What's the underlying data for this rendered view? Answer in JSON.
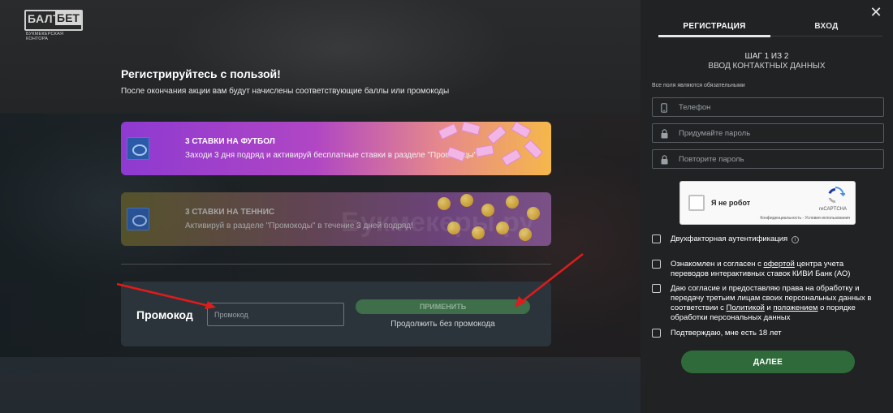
{
  "logo": {
    "part1": "БАЛТ",
    "part2": "БЕТ",
    "tagline": "БУКМЕКЕРСКАЯ КОНТОРА"
  },
  "promo": {
    "title": "Регистрируйтесь с пользой!",
    "subtitle": "После окончания акции вам будут начислены соответствующие баллы или промокоды",
    "cards": [
      {
        "title": "3 СТАВКИ НА ФУТБОЛ",
        "desc": "Заходи 3 дня подряд и активируй бесплатные ставки в разделе \"Промокоды\"!",
        "icon": "card-logo-icon"
      },
      {
        "title": "3 СТАВКИ НА ТЕННИС",
        "desc": "Активируй в разделе \"Промокоды\" в течение 3 дней подряд!",
        "icon": "card-logo-icon"
      }
    ],
    "panel": {
      "label": "Промокод",
      "input_placeholder": "Промокод",
      "apply_label": "ПРИМЕНИТЬ",
      "continue_label": "Продолжить без промокода"
    },
    "watermark": "Букмекеры.ру"
  },
  "registration": {
    "close_icon": "close-icon",
    "tabs": [
      {
        "label": "РЕГИСТРАЦИЯ",
        "active": true
      },
      {
        "label": "ВХОД",
        "active": false
      }
    ],
    "step": "ШАГ 1 ИЗ 2",
    "step_title": "ВВОД КОНТАКТНЫХ ДАННЫХ",
    "required_note": "Все поля являются обязательными",
    "fields": {
      "phone": {
        "placeholder": "Телефон",
        "icon": "phone-icon"
      },
      "password": {
        "placeholder": "Придумайте пароль",
        "icon": "lock-icon"
      },
      "password_repeat": {
        "placeholder": "Повторите пароль",
        "icon": "lock-icon"
      }
    },
    "captcha": {
      "label": "Я не робот",
      "brand": "reCAPTCHA",
      "links": "Конфиденциальность - Условия использования"
    },
    "checkboxes": {
      "two_factor": "Двухфакторная аутентификация",
      "offer": {
        "pre": "Ознакомлен и согласен с ",
        "link": "офертой",
        "post": " центра учета переводов интерактивных ставок КИВИ Банк (АО)"
      },
      "consent": {
        "pre": "Даю согласие и предоставляю права на обработку и передачу третьим лицам своих персональных данных в соответствии с ",
        "link1": "Политикой",
        "mid": " и ",
        "link2": "положением",
        "post": " о порядке обработки персональных данных"
      },
      "age": "Подтверждаю, мне есть 18 лет"
    },
    "next_label": "ДАЛЕЕ"
  },
  "colors": {
    "accent_green": "#2f6b3a",
    "card1_gradient": "#8e3ad1",
    "arrow_red": "#e01b1b"
  }
}
